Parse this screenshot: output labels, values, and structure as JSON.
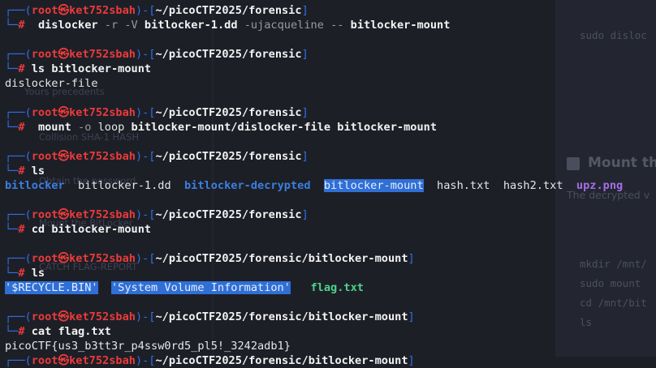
{
  "prompt": {
    "user": "root",
    "skull": "㉿",
    "host": "ket752sbah",
    "path1": "~/picoCTF2025/forensic",
    "path2": "~/picoCTF2025/forensic/bitlocker-mount",
    "symbol": "#"
  },
  "commands": [
    {
      "cmd": "dislocker",
      "args": [
        "-r",
        "-V",
        "bitlocker-1.dd",
        "-ujacqueline",
        "--",
        "bitlocker-mount"
      ]
    },
    {
      "cmd": "ls",
      "args": [
        "bitlocker-mount"
      ]
    },
    {
      "cmd": "mount",
      "args": [
        "-o",
        "loop",
        "bitlocker-mount/dislocker-file",
        "bitlocker-mount"
      ]
    },
    {
      "cmd": "ls",
      "args": []
    },
    {
      "cmd": "cd",
      "args": [
        "bitlocker-mount"
      ]
    },
    {
      "cmd": "ls",
      "args": []
    },
    {
      "cmd": "cat",
      "args": [
        "flag.txt"
      ]
    }
  ],
  "outputs": {
    "ls_mount": "dislocker-file",
    "ls_files": [
      "bitlocker",
      "bitlocker-1.dd",
      "bitlocker-decrypted",
      "bitlocker-mount",
      "hash.txt",
      "hash2.txt",
      "upz.png"
    ],
    "ls_mounted": [
      "'$RECYCLE.BIN'",
      "'System Volume Information'",
      "flag.txt"
    ],
    "flag": "picoCTF{us3_b3tt3r_p4ssw0rd5_pl5!_3242adb1}"
  },
  "background": {
    "sudo_line": "sudo disloc",
    "heading": "Mount th",
    "decrypted": "The decrypted v",
    "code_lines": [
      "mkdir /mnt/",
      "sudo mount ",
      "cd /mnt/bit",
      "ls"
    ],
    "faint_items": [
      "Yours precedents",
      "Collision SHA-1 HASH",
      "Obtain the password",
      "Mount the BitLocker",
      "CATCH FLAG-REPORT"
    ]
  },
  "colors": {
    "background": "#1d1f27",
    "prompt_frame": "#2f6fe6",
    "prompt_user": "#ea3b3b",
    "directory": "#3a7fe0",
    "highlight": "#2f6fd6",
    "executable": "#4bd38a",
    "image_file": "#a46ee6"
  }
}
